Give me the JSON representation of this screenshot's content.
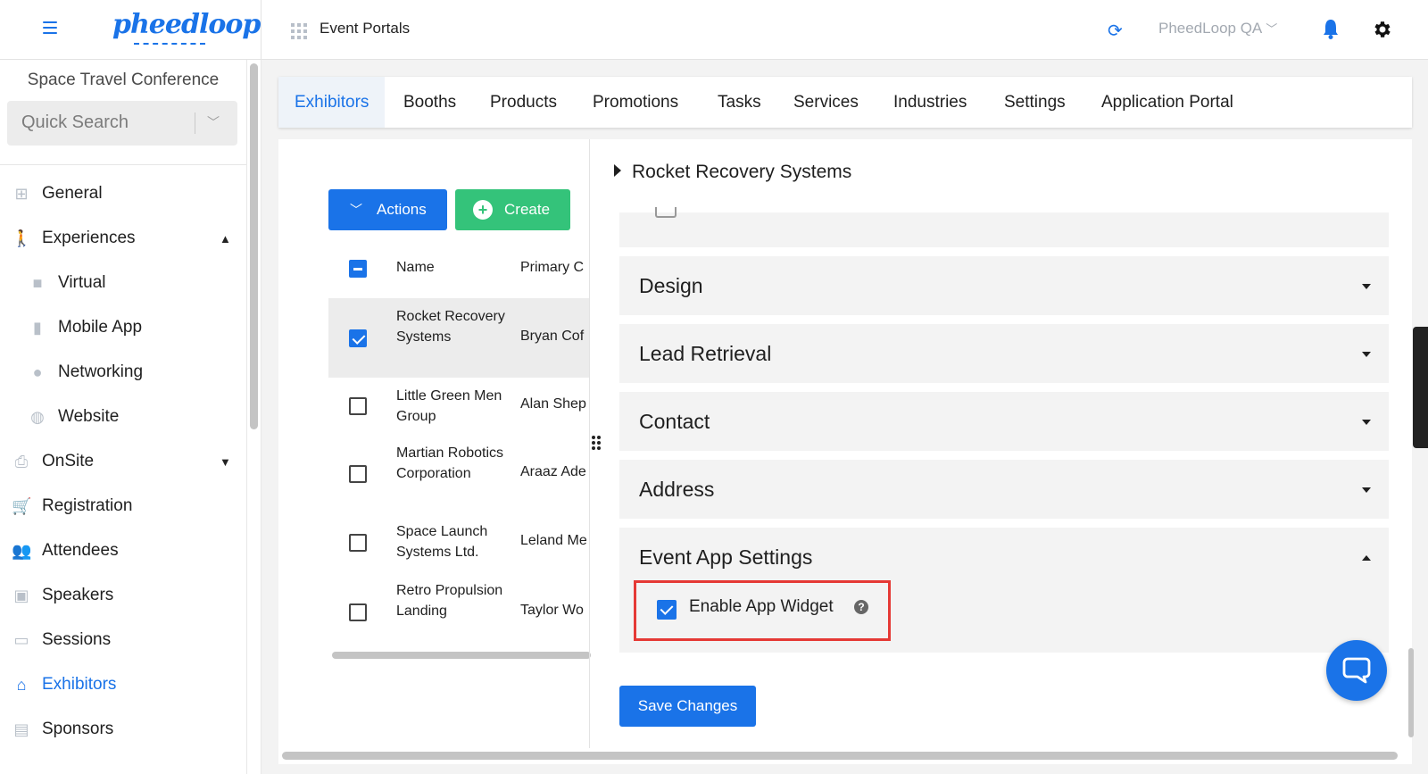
{
  "header": {
    "logo_text": "pheedloop",
    "portal_title": "Event Portals",
    "org_select": "PheedLoop QA"
  },
  "sidebar": {
    "event_name": "Space Travel Conference",
    "search_placeholder": "Quick Search",
    "items": [
      {
        "label": "General",
        "icon": "grid-icon",
        "level": 1
      },
      {
        "label": "Experiences",
        "icon": "person-icon",
        "level": 1,
        "caret": "up"
      },
      {
        "label": "Virtual",
        "icon": "video-icon",
        "level": 2
      },
      {
        "label": "Mobile App",
        "icon": "phone-icon",
        "level": 2
      },
      {
        "label": "Networking",
        "icon": "chat-icon",
        "level": 2
      },
      {
        "label": "Website",
        "icon": "globe-icon",
        "level": 2
      },
      {
        "label": "OnSite",
        "icon": "printer-icon",
        "level": 1,
        "caret": "down"
      },
      {
        "label": "Registration",
        "icon": "cart-icon",
        "level": 1
      },
      {
        "label": "Attendees",
        "icon": "people-icon",
        "level": 1
      },
      {
        "label": "Speakers",
        "icon": "presenter-icon",
        "level": 1
      },
      {
        "label": "Sessions",
        "icon": "laptop-icon",
        "level": 1
      },
      {
        "label": "Exhibitors",
        "icon": "store-icon",
        "level": 1,
        "active": true
      },
      {
        "label": "Sponsors",
        "icon": "badge-icon",
        "level": 1
      }
    ]
  },
  "tabs": [
    "Exhibitors",
    "Booths",
    "Products",
    "Promotions",
    "Tasks",
    "Services",
    "Industries",
    "Settings",
    "Application Portal"
  ],
  "active_tab": "Exhibitors",
  "toolbar": {
    "actions_label": "Actions",
    "create_label": "Create"
  },
  "table": {
    "headers": {
      "name": "Name",
      "contact": "Primary C"
    },
    "rows": [
      {
        "name": "Rocket Recovery Systems",
        "contact": "Bryan Cof",
        "checked": true
      },
      {
        "name": "Little Green Men Group",
        "contact": "Alan Shep",
        "checked": false
      },
      {
        "name": "Martian Robotics Corporation",
        "contact": "Araaz Ade",
        "checked": false
      },
      {
        "name": "Space Launch Systems Ltd.",
        "contact": "Leland Me",
        "checked": false
      },
      {
        "name": "Retro Propulsion Landing",
        "contact": "Taylor Wo",
        "checked": false
      }
    ]
  },
  "detail": {
    "title": "Rocket Recovery Systems",
    "sections": [
      "Design",
      "Lead Retrieval",
      "Contact",
      "Address",
      "Event App Settings"
    ],
    "enable_app_widget_label": "Enable App Widget",
    "enable_app_widget_checked": true,
    "help_glyph": "?",
    "save_label": "Save Changes"
  },
  "colors": {
    "accent": "#1a73e8",
    "create": "#34c37a",
    "highlight": "#e53935"
  }
}
